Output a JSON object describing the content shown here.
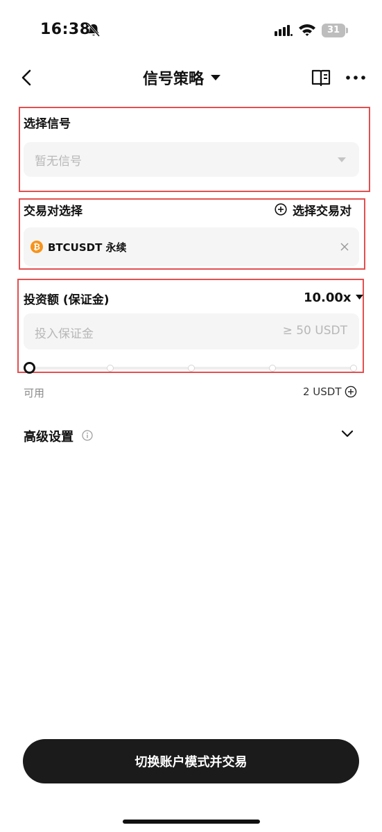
{
  "status_bar": {
    "time": "16:38",
    "battery": "31",
    "icons": [
      "bell-slash-icon",
      "signal-icon",
      "wifi-icon",
      "battery-icon"
    ]
  },
  "nav": {
    "title": "信号策略",
    "icons": [
      "back-chevron-icon",
      "caret-down-icon",
      "book-icon",
      "more-icon"
    ]
  },
  "signal_section": {
    "label": "选择信号",
    "placeholder": "暂无信号"
  },
  "pair_section": {
    "label": "交易对选择",
    "add_label": "选择交易对",
    "selected_pair": "BTCUSDT 永续",
    "coin_symbol": "₿"
  },
  "investment_section": {
    "label": "投资额 (保证金)",
    "leverage": "10.00x",
    "placeholder": "投入保证金",
    "min_hint": "≥ 50 USDT",
    "slider_value_percent": 0,
    "slider_stops": 5
  },
  "available": {
    "label": "可用",
    "value": "2 USDT"
  },
  "advanced": {
    "label": "高级设置"
  },
  "cta": {
    "label": "切换账户模式并交易"
  },
  "colors": {
    "highlight_border": "#e34f4f",
    "button_bg": "#1b1b1b",
    "field_bg": "#f5f5f5",
    "btc_orange": "#f7931a"
  }
}
